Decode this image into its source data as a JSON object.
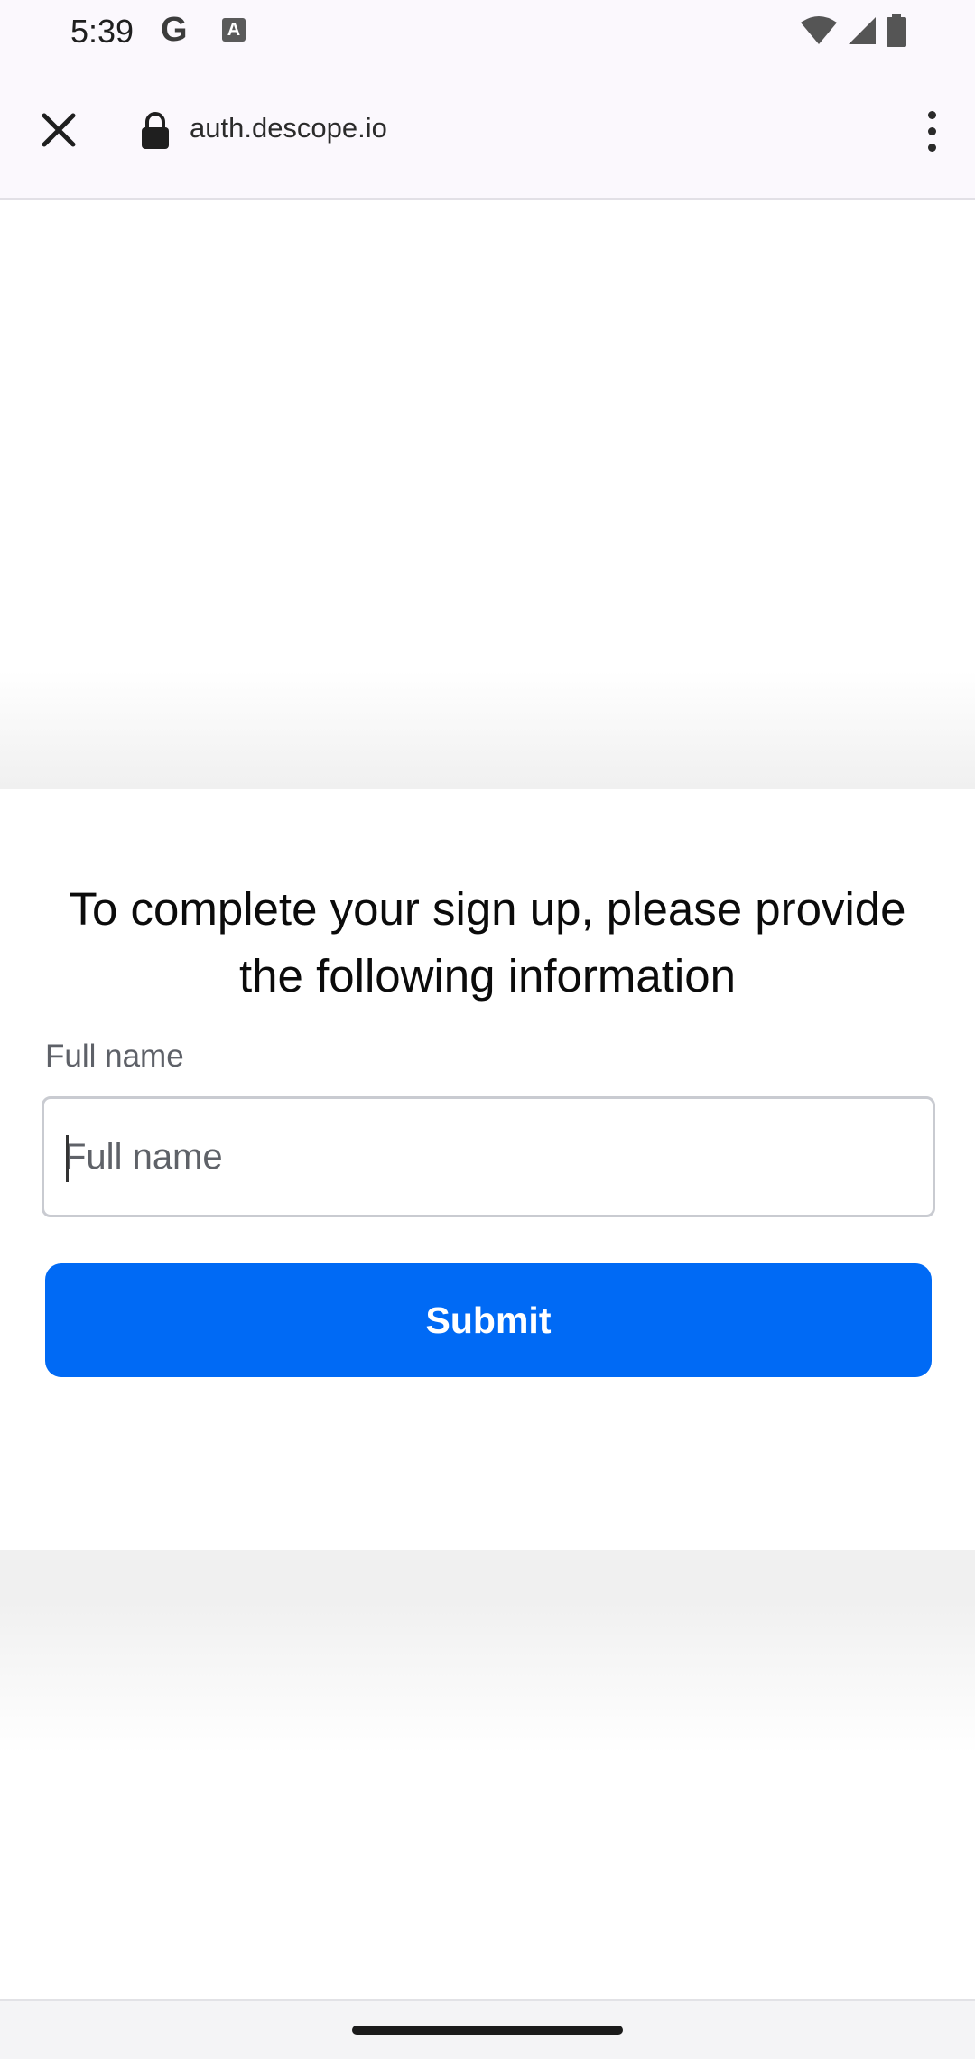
{
  "status_bar": {
    "time": "5:39",
    "google_glyph": "G",
    "app_glyph": "A",
    "icons": [
      "wifi-icon",
      "cellular-signal-icon",
      "battery-icon"
    ]
  },
  "browser": {
    "url": "auth.descope.io",
    "close_icon": "close-icon",
    "lock_icon": "lock-icon",
    "menu_icon": "more-vert-icon"
  },
  "form": {
    "heading": "To complete your sign up, please provide the following information",
    "full_name_label": "Full name",
    "full_name_placeholder": "Full name",
    "full_name_value": "",
    "submit_label": "Submit"
  },
  "colors": {
    "accent": "#006af5",
    "label": "#5e6168",
    "input_border": "#c9cbd1"
  }
}
